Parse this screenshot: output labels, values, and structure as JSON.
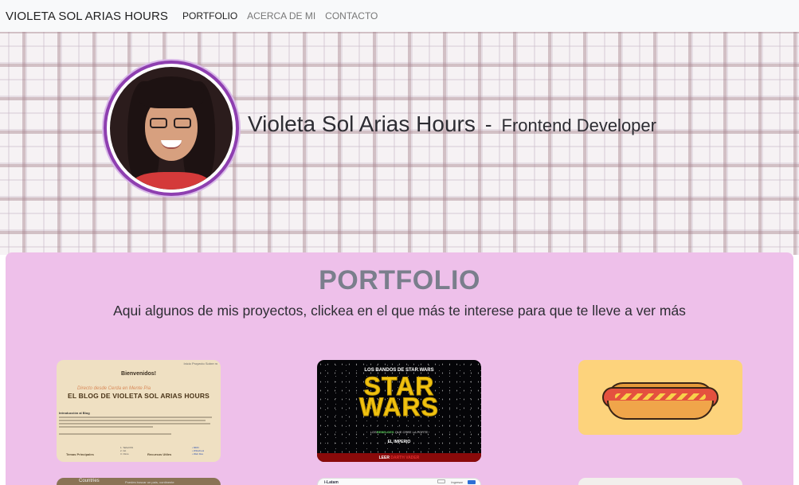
{
  "navbar": {
    "brand": "VIOLETA SOL ARIAS HOURS",
    "links": [
      "PORTFOLIO",
      "ACERCA DE MI",
      "CONTACTO"
    ]
  },
  "hero": {
    "name": "Violeta Sol Arias Hours",
    "separator": "-",
    "role": "Frontend Developer"
  },
  "portfolio": {
    "title": "PORTFOLIO",
    "subtitle": "Aqui algunos de mis proyectos, clickea en el que más te interese para que te lleve a ver más",
    "cards": {
      "blog": {
        "nav": "Inicio   Proyecto   Sobre m",
        "welcome": "Bienvenidos!",
        "script": "Directo desde Cerda en Mente Pia",
        "title": "EL BLOG DE VIOLETA SOL ARIAS HOURS",
        "intro": "Introducción al Blog",
        "footer_left": "Temas Principales",
        "footer_right": "Recursos Utiles",
        "list_left": "1. TailwCSS\n2. Git\n3. Otros",
        "list_right": "• MDN\n• W3school\n• Web Dev"
      },
      "starwars": {
        "band": "LOS BANDOS DE STAR WARS",
        "title_line1": "STAR",
        "title_line2": "WARS",
        "sub_prefix": "LOS",
        "sub_highlight": "REBELDES",
        "sub_suffix": "QUE CREE LA PORTE",
        "empire": "EL IMPERIO",
        "bottom_prefix": "LEER",
        "bottom_highlight": "DARTH VADER"
      },
      "hotdog": {},
      "countries": {
        "title": "Countries",
        "tagline": "Puedes buscar un país, continente"
      },
      "latam": {
        "logo": "i-Latam",
        "link": "Ingresar"
      },
      "sixth": {}
    }
  },
  "colors": {
    "navbar_bg": "#f8f9fa",
    "portfolio_bg": "#eec0ea",
    "avatar_ring": "#8e3fb0",
    "title_gray": "#7a7e8c"
  }
}
